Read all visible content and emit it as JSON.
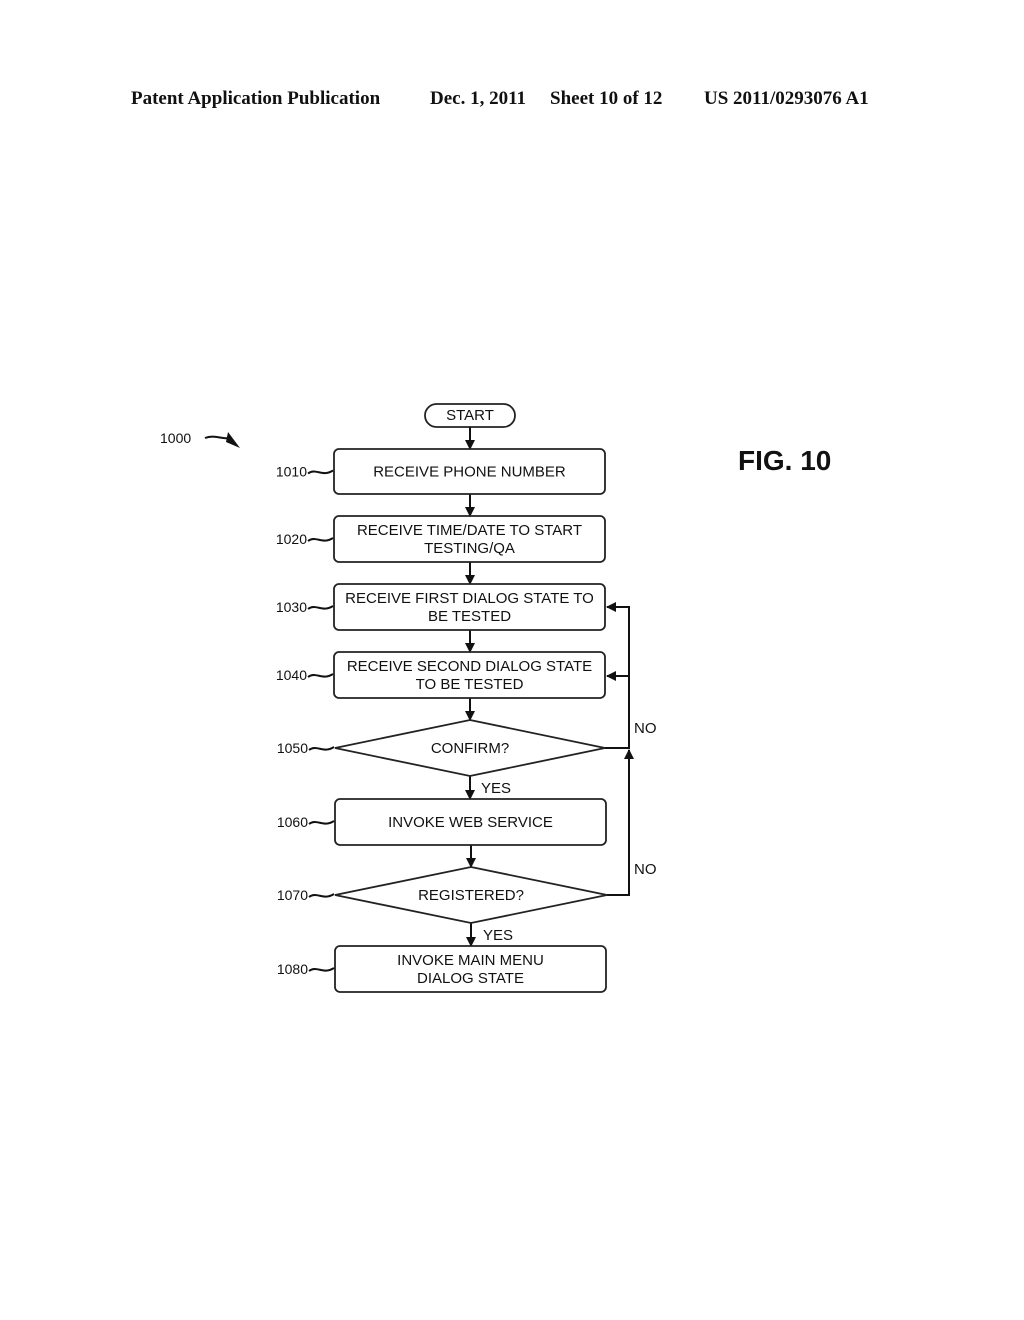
{
  "header": {
    "publication": "Patent Application Publication",
    "date": "Dec. 1, 2011",
    "sheet": "Sheet 10 of 12",
    "number": "US 2011/0293076 A1"
  },
  "figure": {
    "label": "FIG. 10",
    "ref": "1000",
    "start": "START",
    "steps": [
      {
        "ref": "1010",
        "lines": [
          "RECEIVE PHONE NUMBER"
        ]
      },
      {
        "ref": "1020",
        "lines": [
          "RECEIVE TIME/DATE TO START",
          "TESTING/QA"
        ]
      },
      {
        "ref": "1030",
        "lines": [
          "RECEIVE FIRST DIALOG STATE TO",
          "BE TESTED"
        ]
      },
      {
        "ref": "1040",
        "lines": [
          "RECEIVE SECOND DIALOG STATE",
          "TO BE TESTED"
        ]
      },
      {
        "ref": "1050",
        "lines": [
          "CONFIRM?"
        ]
      },
      {
        "ref": "1060",
        "lines": [
          "INVOKE WEB SERVICE"
        ]
      },
      {
        "ref": "1070",
        "lines": [
          "REGISTERED?"
        ]
      },
      {
        "ref": "1080",
        "lines": [
          "INVOKE MAIN MENU",
          "DIALOG STATE"
        ]
      }
    ],
    "yes_label": "YES",
    "no_label": "NO"
  }
}
